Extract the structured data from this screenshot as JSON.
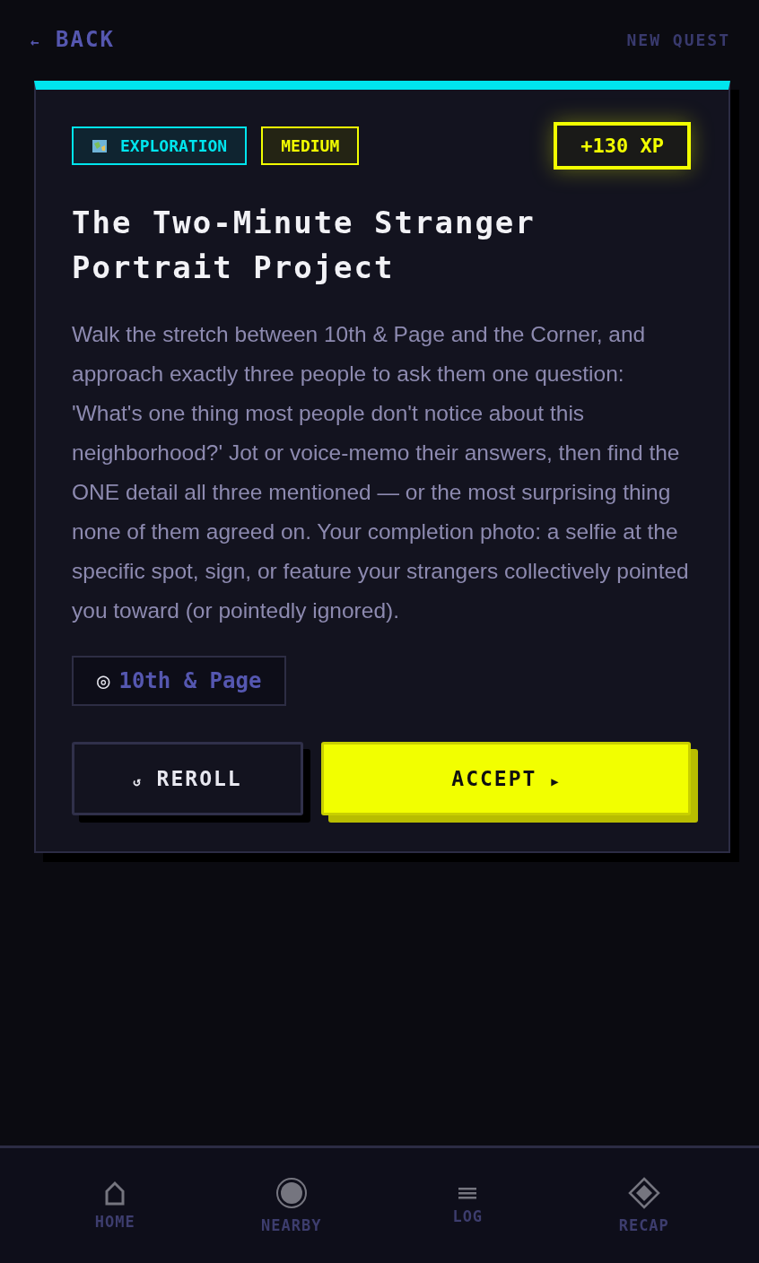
{
  "header": {
    "back_icon": "←",
    "back": "BACK",
    "title": "NEW QUEST"
  },
  "quest": {
    "category": "EXPLORATION",
    "difficulty": "MEDIUM",
    "xp": "+130 XP",
    "title": "The Two-Minute Stranger Portrait Project",
    "description": "Walk the stretch between 10th & Page and the Corner, and approach exactly three people to ask them one question: 'What's one thing most people don't notice about this neighborhood?' Jot or voice-memo their answers, then find the ONE detail all three mentioned — or the most surprising thing none of them agreed on. Your completion photo: a selfie at the specific spot, sign, or feature your strangers collectively pointed you toward (or pointedly ignored).",
    "location_icon": "◎",
    "location": "10th & Page",
    "buttons": [
      {
        "kind": "secondary",
        "icon": "↺",
        "label": "REROLL"
      },
      {
        "kind": "primary",
        "icon": "▶",
        "label": "ACCEPT"
      }
    ]
  },
  "nav": [
    {
      "kind": "home",
      "label": "HOME"
    },
    {
      "kind": "nearby",
      "label": "NEARBY"
    },
    {
      "kind": "log",
      "label": "LOG"
    },
    {
      "kind": "recap",
      "label": "RECAP"
    }
  ]
}
